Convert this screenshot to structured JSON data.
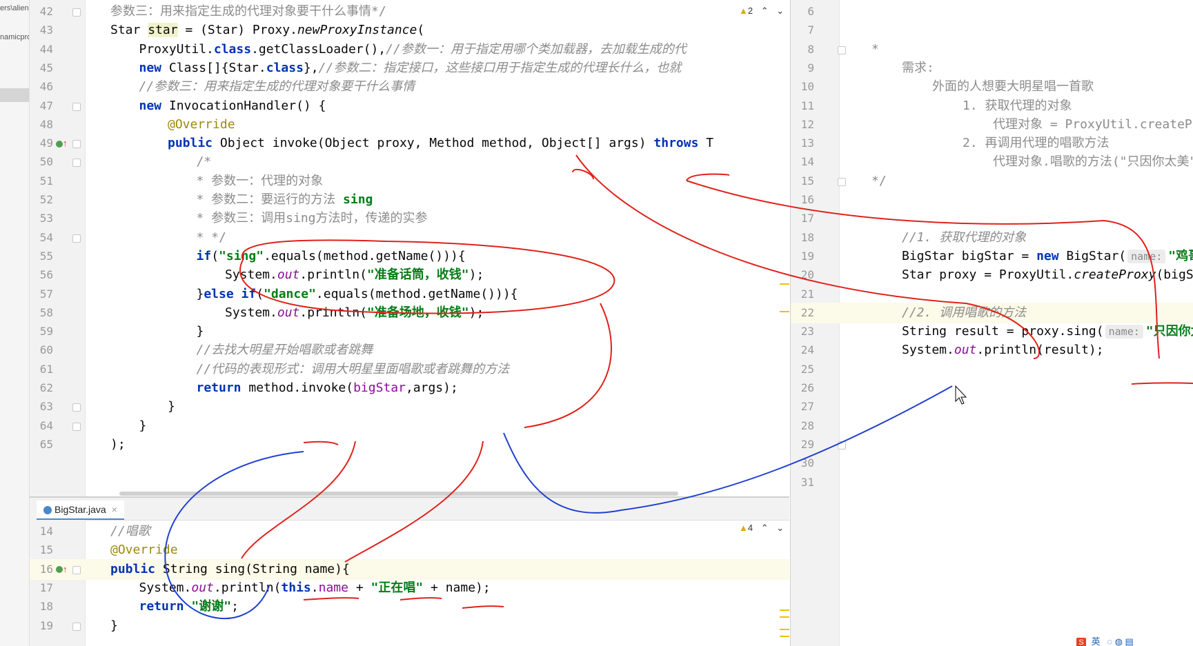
{
  "side_panel": {
    "path_fragment": "ers\\alien",
    "project_fragment": "namicpro"
  },
  "editor_top": {
    "warnings": "2",
    "lines": [
      {
        "n": "42"
      },
      {
        "n": "43"
      },
      {
        "n": "44"
      },
      {
        "n": "45"
      },
      {
        "n": "46"
      },
      {
        "n": "47"
      },
      {
        "n": "48"
      },
      {
        "n": "49"
      },
      {
        "n": "50"
      },
      {
        "n": "51"
      },
      {
        "n": "52"
      },
      {
        "n": "53"
      },
      {
        "n": "54"
      },
      {
        "n": "55"
      },
      {
        "n": "56"
      },
      {
        "n": "57"
      },
      {
        "n": "58"
      },
      {
        "n": "59"
      },
      {
        "n": "60"
      },
      {
        "n": "61"
      },
      {
        "n": "62"
      },
      {
        "n": "63"
      },
      {
        "n": "64"
      },
      {
        "n": "65"
      }
    ],
    "t": {
      "l42": "参数三：用来指定生成的代理对象要干什么事情*/",
      "l43a": "Star ",
      "l43b": "star",
      "l43c": " = (Star) Proxy.",
      "l43d": "newProxyInstance",
      "l43e": "(",
      "l44a": "ProxyUtil.",
      "l44b": "class",
      "l44c": ".getClassLoader(),",
      "l44d": "//参数一：用于指定用哪个类加载器，去加载生成的代",
      "l45a": "new",
      "l45b": " Class[]{Star.",
      "l45c": "class",
      "l45d": "},",
      "l45e": "//参数二：指定接口，这些接口用于指定生成的代理长什么，也就",
      "l46": "//参数三：用来指定生成的代理对象要干什么事情",
      "l47a": "new",
      "l47b": " InvocationHandler() {",
      "l48": "@Override",
      "l49a": "public",
      "l49b": " Object invoke(Object proxy, Method method, Object[] args) ",
      "l49c": "throws",
      "l49d": " T",
      "l50": "/*",
      "l51": "* 参数一：代理的对象",
      "l52a": "* 参数二：要运行的方法 ",
      "l52b": "sing",
      "l53": "* 参数三：调用sing方法时，传递的实参",
      "l54": "* */",
      "l55a": "if",
      "l55b": "(",
      "l55c": "\"sing\"",
      "l55d": ".equals(method.getName())){",
      "l56a": "System.",
      "l56b": "out",
      "l56c": ".println(",
      "l56d": "\"准备话筒，收钱\"",
      "l56e": ");",
      "l57a": "}",
      "l57b": "else if",
      "l57c": "(",
      "l57d": "\"dance\"",
      "l57e": ".equals(method.getName())){",
      "l58a": "System.",
      "l58b": "out",
      "l58c": ".println(",
      "l58d": "\"准备场地，收钱\"",
      "l58e": ");",
      "l59": "}",
      "l60": "//去找大明星开始唱歌或者跳舞",
      "l61": "//代码的表现形式：调用大明星里面唱歌或者跳舞的方法",
      "l62a": "return",
      "l62b": " method.invoke(",
      "l62c": "bigStar",
      "l62d": ",args);",
      "l63": "}",
      "l64": "}",
      "l65": ");"
    }
  },
  "editor_bottom": {
    "tab": "BigStar.java",
    "warnings": "4",
    "lines": [
      {
        "n": "14"
      },
      {
        "n": "15"
      },
      {
        "n": "16"
      },
      {
        "n": "17"
      },
      {
        "n": "18"
      },
      {
        "n": "19"
      }
    ],
    "t": {
      "l14": "//唱歌",
      "l15": "@Override",
      "l16a": "public",
      "l16b": " String sing(String name){",
      "l17a": "System.",
      "l17b": "out",
      "l17c": ".println(",
      "l17d": "this",
      "l17e": ".",
      "l17f": "name",
      "l17g": " + ",
      "l17h": "\"正在唱\"",
      "l17i": " + name);",
      "l18a": "return",
      "l18b": " ",
      "l18c": "\"谢谢\"",
      "l18d": ";",
      "l19": "}"
    }
  },
  "editor_right": {
    "lines": [
      {
        "n": "6"
      },
      {
        "n": "7"
      },
      {
        "n": "8"
      },
      {
        "n": "9"
      },
      {
        "n": "10"
      },
      {
        "n": "11"
      },
      {
        "n": "12"
      },
      {
        "n": "13"
      },
      {
        "n": "14"
      },
      {
        "n": "15"
      },
      {
        "n": "16"
      },
      {
        "n": "17"
      },
      {
        "n": "18"
      },
      {
        "n": "19"
      },
      {
        "n": "20"
      },
      {
        "n": "21"
      },
      {
        "n": "22"
      },
      {
        "n": "23"
      },
      {
        "n": "24"
      },
      {
        "n": "25"
      },
      {
        "n": "26"
      },
      {
        "n": "27"
      },
      {
        "n": "28"
      },
      {
        "n": "29"
      },
      {
        "n": "30"
      },
      {
        "n": "31"
      }
    ],
    "t": {
      "l8": "*",
      "l9": "需求:",
      "l10": "外面的人想要大明星唱一首歌",
      "l11": "1. 获取代理的对象",
      "l12": "代理对象 = ProxyUtil.createProxy(大",
      "l13": "2. 再调用代理的唱歌方法",
      "l14": "代理对象.唱歌的方法(\"只因你太美\");",
      "l15": "*/",
      "l18": "//1. 获取代理的对象",
      "l19a": "BigStar bigStar = ",
      "l19b": "new",
      "l19c": " BigStar(",
      "l19h": "name:",
      "l19d": "\"鸡哥",
      "l20a": "Star proxy = ProxyUtil.",
      "l20b": "createProxy",
      "l20c": "(bigSta",
      "l22": "//2. 调用唱歌的方法",
      "l23a": "String result = proxy.sing(",
      "l23h": "name:",
      "l23b": "\"只因你太",
      "l24a": "System.",
      "l24b": "out",
      "l24c": ".println(result);"
    }
  },
  "taskbar_fragment": "英"
}
